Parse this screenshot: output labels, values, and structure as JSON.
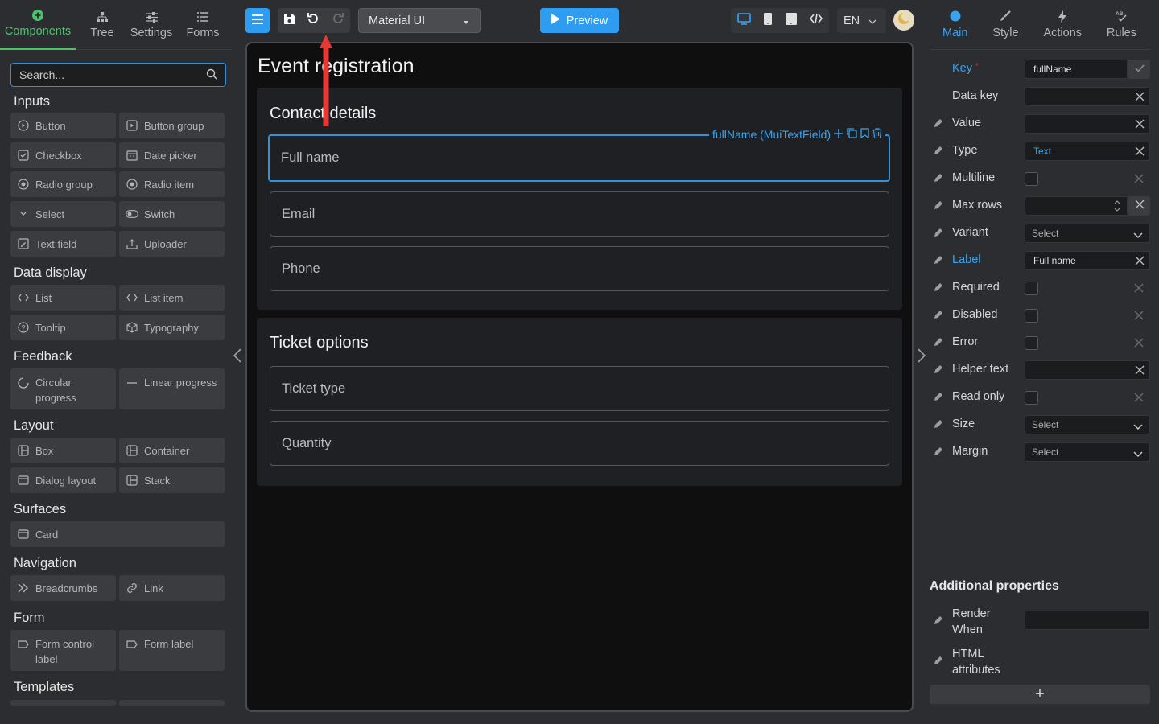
{
  "left_tabs": [
    {
      "label": "Components",
      "icon": "plus-circle-icon",
      "active": true
    },
    {
      "label": "Tree",
      "icon": "tree-icon"
    },
    {
      "label": "Settings",
      "icon": "settings-sliders-icon"
    },
    {
      "label": "Forms",
      "icon": "list-icon"
    }
  ],
  "search": {
    "placeholder": "Search..."
  },
  "sections": {
    "inputs": "Inputs",
    "data_display": "Data display",
    "feedback": "Feedback",
    "layout": "Layout",
    "surfaces": "Surfaces",
    "navigation": "Navigation",
    "form": "Form",
    "templates": "Templates"
  },
  "components": {
    "button": "Button",
    "button_group": "Button group",
    "checkbox": "Checkbox",
    "date_picker": "Date picker",
    "radio_group": "Radio group",
    "radio_item": "Radio item",
    "select": "Select",
    "switch": "Switch",
    "text_field": "Text field",
    "uploader": "Uploader",
    "list": "List",
    "list_item": "List item",
    "tooltip": "Tooltip",
    "typography": "Typography",
    "circular_progress": "Circular progress",
    "linear_progress": "Linear progress",
    "box": "Box",
    "container": "Container",
    "dialog_layout": "Dialog layout",
    "stack": "Stack",
    "card": "Card",
    "breadcrumbs": "Breadcrumbs",
    "link": "Link",
    "form_control_label": "Form control label",
    "form_label": "Form label"
  },
  "toolbar": {
    "ui_library": "Material UI",
    "preview": "Preview",
    "language": "EN"
  },
  "canvas": {
    "title": "Event registration",
    "contact_title": "Contact details",
    "selected_label": "fullName (MuiTextField)",
    "fields": {
      "full_name": "Full name",
      "email": "Email",
      "phone": "Phone",
      "ticket_type": "Ticket type",
      "quantity": "Quantity"
    },
    "ticket_title": "Ticket options"
  },
  "right_tabs": [
    {
      "label": "Main",
      "active": true
    },
    {
      "label": "Style"
    },
    {
      "label": "Actions"
    },
    {
      "label": "Rules"
    }
  ],
  "props": {
    "key_label": "Key",
    "key_required": "*",
    "key_value": "fullName",
    "data_key": "Data key",
    "value": "Value",
    "type": "Type",
    "type_value": "Text",
    "multiline": "Multiline",
    "max_rows": "Max rows",
    "variant": "Variant",
    "label": "Label",
    "label_value": "Full name",
    "required": "Required",
    "disabled": "Disabled",
    "error": "Error",
    "helper_text": "Helper text",
    "read_only": "Read only",
    "size": "Size",
    "margin": "Margin",
    "select_placeholder": "Select"
  },
  "additional": {
    "title": "Additional properties",
    "render_when_1": "Render",
    "render_when_2": "When",
    "html_attr_1": "HTML",
    "html_attr_2": "attributes",
    "add": "+"
  },
  "colors": {
    "accent_green": "#4ec16f",
    "accent_blue": "#3aa3f0",
    "annotation_red": "#e53935"
  }
}
